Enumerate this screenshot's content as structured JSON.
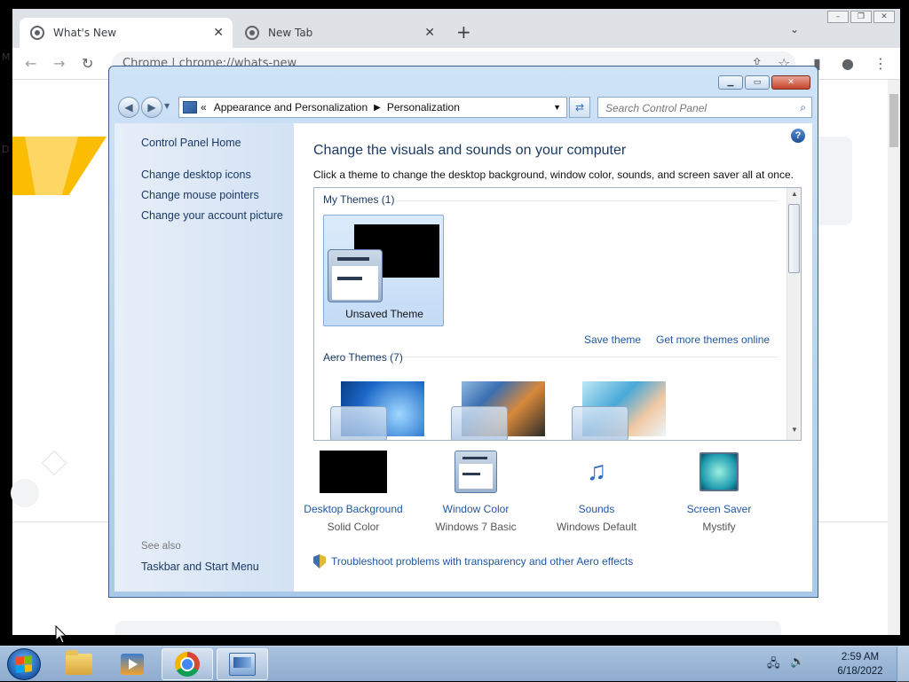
{
  "chrome": {
    "tabs": [
      {
        "title": "What's New"
      },
      {
        "title": "New Tab"
      }
    ],
    "address": "Chrome  |  chrome://whats-new",
    "side_letters": [
      "M",
      "D"
    ]
  },
  "cp": {
    "breadcrumb": [
      "Appearance and Personalization",
      "Personalization"
    ],
    "breadcrumb_prefix": "«",
    "search_placeholder": "Search Control Panel",
    "left": {
      "home": "Control Panel Home",
      "links": [
        "Change desktop icons",
        "Change mouse pointers",
        "Change your account picture"
      ],
      "see_also": "See also",
      "see_also_links": [
        "Taskbar and Start Menu"
      ]
    },
    "heading": "Change the visuals and sounds on your computer",
    "subtitle": "Click a theme to change the desktop background, window color, sounds, and screen saver all at once.",
    "my_themes": "My Themes (1)",
    "unsaved_theme": "Unsaved Theme",
    "save_theme": "Save theme",
    "get_more": "Get more themes online",
    "aero_themes": "Aero Themes (7)",
    "settings": [
      {
        "name": "Desktop Background",
        "value": "Solid Color",
        "icon": "black-swatch-icon"
      },
      {
        "name": "Window Color",
        "value": "Windows 7 Basic",
        "icon": "window-color-icon"
      },
      {
        "name": "Sounds",
        "value": "Windows Default",
        "icon": "music-notes-icon"
      },
      {
        "name": "Screen Saver",
        "value": "Mystify",
        "icon": "screen-saver-icon"
      }
    ],
    "troubleshoot": "Troubleshoot problems with transparency and other Aero effects"
  },
  "taskbar": {
    "time": "2:59 AM",
    "date": "6/18/2022"
  }
}
